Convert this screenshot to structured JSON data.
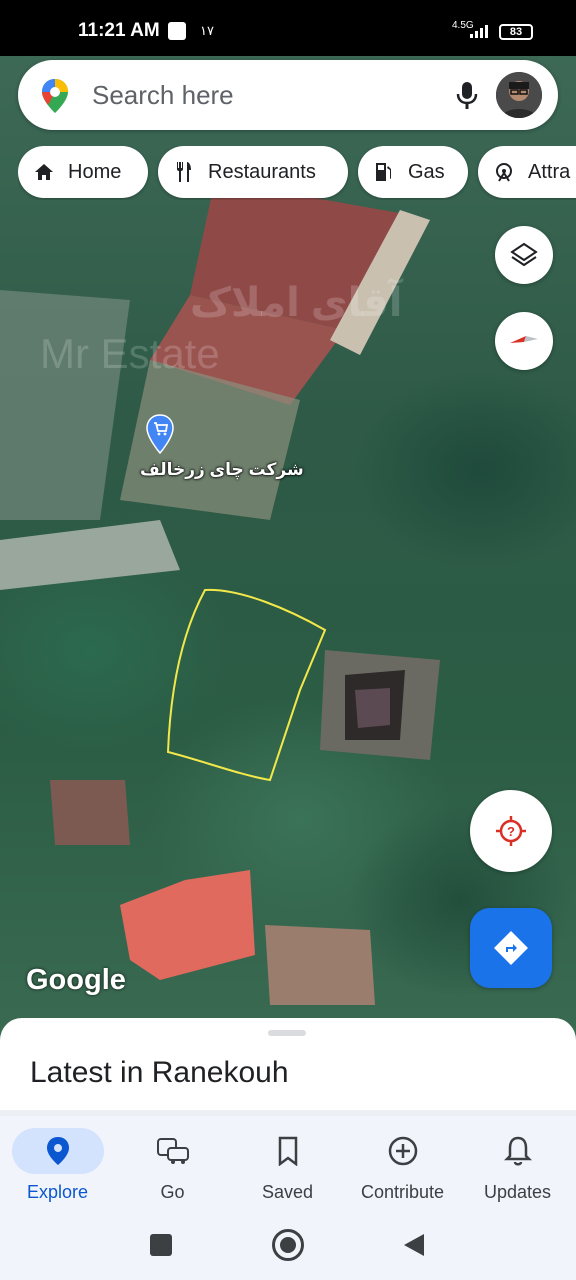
{
  "status_bar": {
    "time": "11:21 AM",
    "extra": "۱۷",
    "network": "4.5G",
    "battery": "83"
  },
  "search": {
    "placeholder": "Search here",
    "logo_icon": "google-maps-pin-icon",
    "mic_icon": "mic-icon"
  },
  "chips": [
    {
      "label": "Home",
      "icon": "home-icon"
    },
    {
      "label": "Restaurants",
      "icon": "restaurant-icon"
    },
    {
      "label": "Gas",
      "icon": "gas-station-icon"
    },
    {
      "label": "Attra",
      "icon": "attractions-icon"
    }
  ],
  "map": {
    "place_label": "شرکت چای زرخالف",
    "place_icon": "shopping-cart-pin-icon",
    "attribution": "Google",
    "watermark_fa": "آقای املاک",
    "watermark_en": "Mr Estate",
    "layers_icon": "layers-icon",
    "compass_icon": "compass-icon",
    "location_icon": "my-location-icon",
    "directions_icon": "directions-icon",
    "accent": "#1a73e8"
  },
  "sheet": {
    "title": "Latest in Ranekouh"
  },
  "bottom_nav": [
    {
      "label": "Explore",
      "icon": "explore-pin-icon",
      "active": true
    },
    {
      "label": "Go",
      "icon": "commute-icon"
    },
    {
      "label": "Saved",
      "icon": "bookmark-icon"
    },
    {
      "label": "Contribute",
      "icon": "add-circle-icon"
    },
    {
      "label": "Updates",
      "icon": "bell-icon"
    }
  ]
}
